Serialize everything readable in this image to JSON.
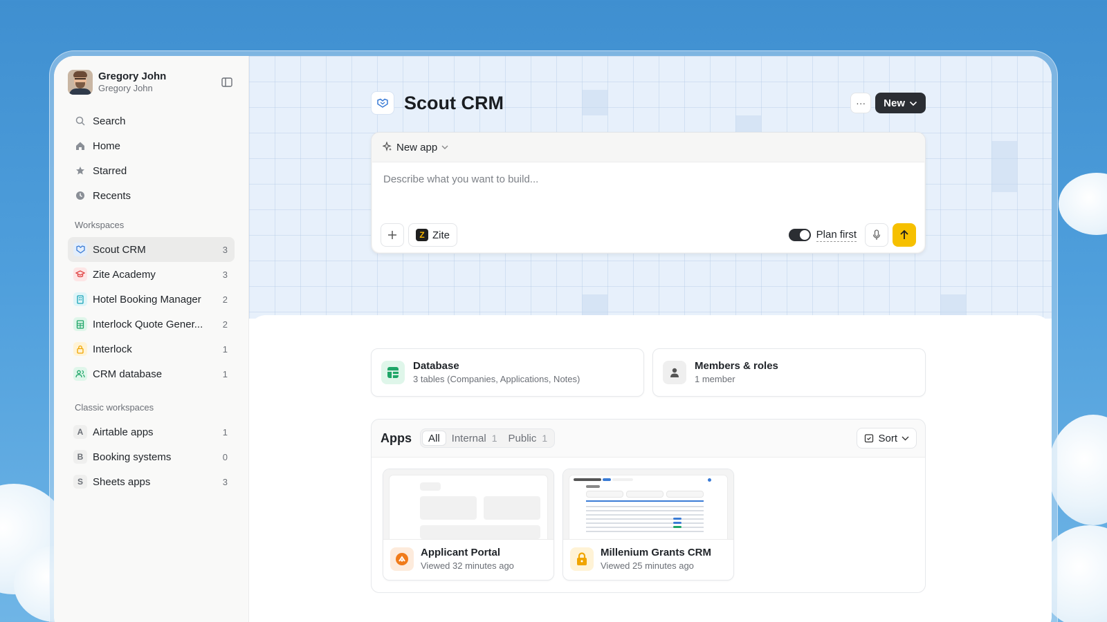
{
  "user": {
    "name": "Gregory John",
    "subtitle": "Gregory John"
  },
  "nav": [
    {
      "label": "Search",
      "icon": "search-icon"
    },
    {
      "label": "Home",
      "icon": "home-icon"
    },
    {
      "label": "Starred",
      "icon": "star-icon"
    },
    {
      "label": "Recents",
      "icon": "clock-icon"
    }
  ],
  "workspaces_label": "Workspaces",
  "workspaces": [
    {
      "label": "Scout CRM",
      "count": "3",
      "icon": "handshake-icon",
      "color": "#3a7bd5",
      "bg": "#e3eefb",
      "active": true
    },
    {
      "label": "Zite Academy",
      "count": "3",
      "icon": "graduation-cap-icon",
      "color": "#e04848",
      "bg": "#fde6e6"
    },
    {
      "label": "Hotel Booking Manager",
      "count": "2",
      "icon": "building-icon",
      "color": "#19a3b8",
      "bg": "#dff5f8"
    },
    {
      "label": "Interlock Quote Gener...",
      "count": "2",
      "icon": "spreadsheet-icon",
      "color": "#1ea567",
      "bg": "#dff6ea"
    },
    {
      "label": "Interlock",
      "count": "1",
      "icon": "lock-icon",
      "color": "#f0a500",
      "bg": "#fff3d6"
    },
    {
      "label": "CRM database",
      "count": "1",
      "icon": "users-icon",
      "color": "#1ea567",
      "bg": "#dff6ea"
    }
  ],
  "classic_label": "Classic workspaces",
  "classic": [
    {
      "letter": "A",
      "label": "Airtable apps",
      "count": "1"
    },
    {
      "letter": "B",
      "label": "Booking systems",
      "count": "0"
    },
    {
      "letter": "S",
      "label": "Sheets apps",
      "count": "3"
    }
  ],
  "page": {
    "title": "Scout CRM",
    "more": "···",
    "new_label": "New"
  },
  "composer": {
    "mode": "New app",
    "placeholder": "Describe what you want to build...",
    "model": "Zite",
    "plan_label": "Plan first",
    "plan_enabled": true
  },
  "cards": {
    "database": {
      "title": "Database",
      "subtitle": "3 tables (Companies, Applications, Notes)"
    },
    "members": {
      "title": "Members & roles",
      "subtitle": "1 member"
    }
  },
  "apps": {
    "title": "Apps",
    "tabs": [
      {
        "label": "All",
        "count": ""
      },
      {
        "label": "Internal",
        "count": "1"
      },
      {
        "label": "Public",
        "count": "1"
      }
    ],
    "sort_label": "Sort",
    "items": [
      {
        "name": "Applicant Portal",
        "viewed": "Viewed 32 minutes ago",
        "icon": "orange-badge-icon",
        "color": "#f07b1a"
      },
      {
        "name": "Millenium Grants CRM",
        "viewed": "Viewed 25 minutes ago",
        "icon": "lock-icon",
        "color": "#f0a500"
      }
    ]
  }
}
